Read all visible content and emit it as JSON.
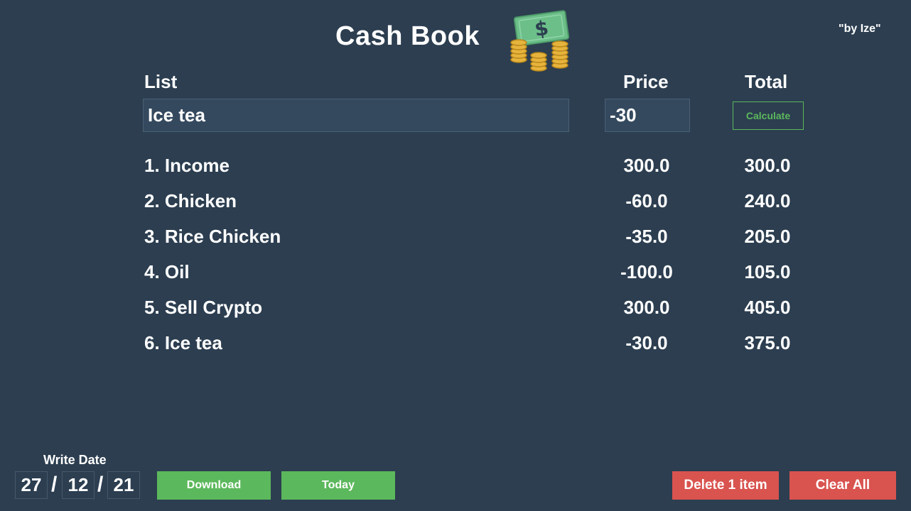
{
  "header": {
    "title": "Cash Book",
    "byline": "\"by Ize\"",
    "logo_icon": "money-coins-icon"
  },
  "columns": {
    "list": "List",
    "price": "Price",
    "total": "Total"
  },
  "form": {
    "item_value": "Ice tea",
    "price_value": "-30",
    "calculate_label": "Calculate"
  },
  "entries": [
    {
      "name": "1. Income",
      "price": "300.0",
      "total": "300.0"
    },
    {
      "name": "2. Chicken",
      "price": "-60.0",
      "total": "240.0"
    },
    {
      "name": "3. Rice Chicken",
      "price": "-35.0",
      "total": "205.0"
    },
    {
      "name": "4. Oil",
      "price": "-100.0",
      "total": "105.0"
    },
    {
      "name": "5. Sell Crypto",
      "price": "300.0",
      "total": "405.0"
    },
    {
      "name": "6. Ice tea",
      "price": "-30.0",
      "total": "375.0"
    }
  ],
  "footer": {
    "date_label": "Write Date",
    "day": "27",
    "month": "12",
    "year": "21",
    "separator": "/",
    "download_label": "Download",
    "today_label": "Today",
    "delete_label": "Delete 1 item",
    "clear_label": "Clear All"
  },
  "colors": {
    "background": "#2c3e50",
    "input_bg": "#34495e",
    "green": "#5cb85c",
    "red": "#d9534f",
    "text": "#ffffff"
  }
}
